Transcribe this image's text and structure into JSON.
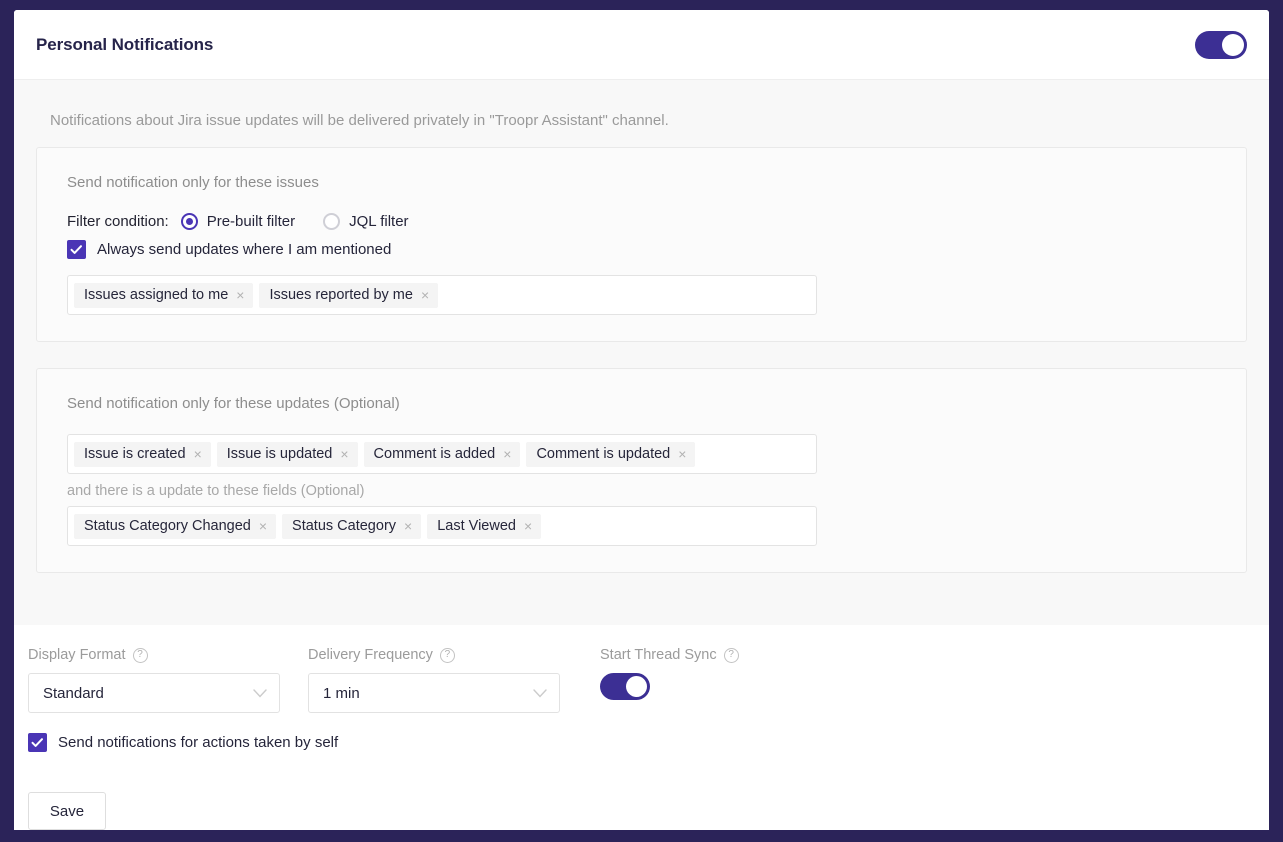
{
  "header": {
    "title": "Personal Notifications",
    "master_toggle": {
      "name": "master-toggle",
      "state": "on"
    }
  },
  "intro": {
    "text": "Notifications about Jira issue updates will be delivered privately in \"Troopr Assistant\" channel."
  },
  "issues_panel": {
    "title": "Send notification only for these issues",
    "filter_label": "Filter condition:",
    "options": [
      {
        "label": "Pre-built filter",
        "selected": true
      },
      {
        "label": "JQL filter",
        "selected": false
      }
    ],
    "mention_checkbox": {
      "label": "Always send updates where I am mentioned",
      "checked": true
    },
    "tags": [
      {
        "label": "Issues assigned to me",
        "remove": "×"
      },
      {
        "label": "Issues reported by me",
        "remove": "×"
      }
    ]
  },
  "updates_panel": {
    "title": "Send notification only for these updates (Optional)",
    "update_tags": [
      {
        "label": "Issue is created",
        "remove": "×"
      },
      {
        "label": "Issue is updated",
        "remove": "×"
      },
      {
        "label": "Comment is added",
        "remove": "×"
      },
      {
        "label": "Comment is updated",
        "remove": "×"
      }
    ],
    "fields_sub_label": "and there is a update to these fields (Optional)",
    "field_tags": [
      {
        "label": "Status Category Changed",
        "remove": "×"
      },
      {
        "label": "Status Category",
        "remove": "×"
      },
      {
        "label": "Last Viewed",
        "remove": "×"
      }
    ]
  },
  "controls": {
    "display_format": {
      "label": "Display Format",
      "help": "?",
      "value": "Standard",
      "chevron": "⌄"
    },
    "delivery_frequency": {
      "label": "Delivery Frequency",
      "help": "?",
      "value": "1 min",
      "chevron": "⌄"
    },
    "start_thread_sync": {
      "label": "Start Thread Sync",
      "help": "?",
      "state": "on"
    },
    "self_actions_checkbox": {
      "label": "Send notifications for actions taken by self",
      "checked": true
    },
    "save_label": "Save"
  },
  "colors": {
    "frame": "#2b2359",
    "accent": "#4a35b5",
    "toggle_on": "#3c2f94",
    "title": "#26244a",
    "muted_text": "#9a9a9a"
  }
}
